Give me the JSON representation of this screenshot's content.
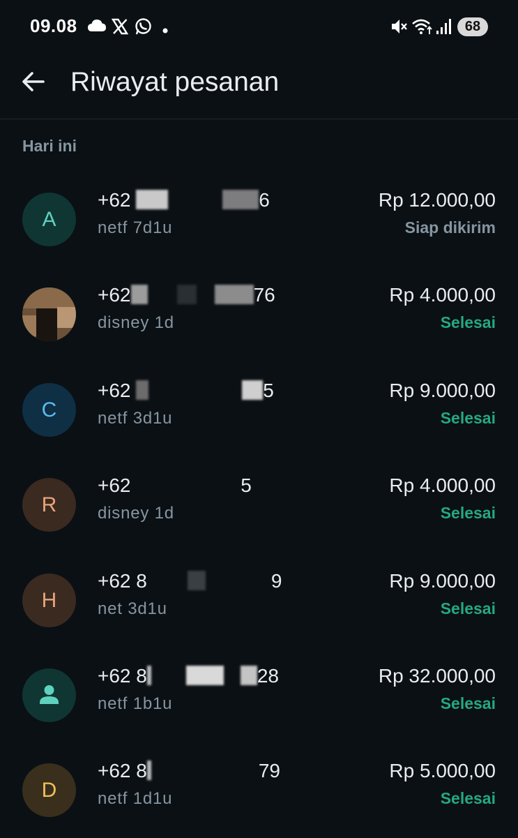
{
  "status_bar": {
    "time": "09.08",
    "battery": "68",
    "icons": [
      "cloud-icon",
      "x-logo-icon",
      "whatsapp-icon",
      "dot-icon",
      "mute-icon",
      "wifi-icon",
      "signal-icon"
    ]
  },
  "header": {
    "back_icon": "arrow-left-icon",
    "title": "Riwayat pesanan"
  },
  "section": {
    "label": "Hari ini"
  },
  "colors": {
    "background": "#0b1014",
    "status_done": "#25a884",
    "status_pending": "#8696a0",
    "secondary_text": "#8696a0"
  },
  "orders": [
    {
      "avatar_letter": "A",
      "avatar_bg": "#0f3633",
      "avatar_fg": "#5fd1bf",
      "phone_start": "+62",
      "phone_end": "6",
      "product": "netf 7d1u",
      "amount": "Rp 12.000,00",
      "status": "Siap dikirim",
      "status_color": "#8696a0"
    },
    {
      "avatar_letter": "",
      "avatar_bg": "#3a2a1e",
      "avatar_fg": "#c9a27a",
      "phone_start": "+62",
      "phone_end": "76",
      "product": "disney 1d",
      "amount": "Rp 4.000,00",
      "status": "Selesai",
      "status_color": "#25a884"
    },
    {
      "avatar_letter": "C",
      "avatar_bg": "#0f2f45",
      "avatar_fg": "#5ebcf0",
      "phone_start": "+62",
      "phone_end": "5",
      "product": "netf 3d1u",
      "amount": "Rp 9.000,00",
      "status": "Selesai",
      "status_color": "#25a884"
    },
    {
      "avatar_letter": "R",
      "avatar_bg": "#3b2a20",
      "avatar_fg": "#e8a47a",
      "phone_start": "+62",
      "phone_end": "5",
      "product": "disney 1d",
      "amount": "Rp 4.000,00",
      "status": "Selesai",
      "status_color": "#25a884"
    },
    {
      "avatar_letter": "H",
      "avatar_bg": "#3b2a20",
      "avatar_fg": "#e8a47a",
      "phone_start": "+62 8",
      "phone_end": "9",
      "product": "net 3d1u",
      "amount": "Rp 9.000,00",
      "status": "Selesai",
      "status_color": "#25a884"
    },
    {
      "avatar_letter": "",
      "avatar_bg": "#0f3633",
      "avatar_fg": "#5fd1bf",
      "phone_start": "+62 8",
      "phone_end": "28",
      "product": "netf 1b1u",
      "amount": "Rp 32.000,00",
      "status": "Selesai",
      "status_color": "#25a884"
    },
    {
      "avatar_letter": "D",
      "avatar_bg": "#3a2f1c",
      "avatar_fg": "#f0c05a",
      "phone_start": "+62 8",
      "phone_end": "79",
      "product": "netf 1d1u",
      "amount": "Rp 5.000,00",
      "status": "Selesai",
      "status_color": "#25a884"
    }
  ]
}
